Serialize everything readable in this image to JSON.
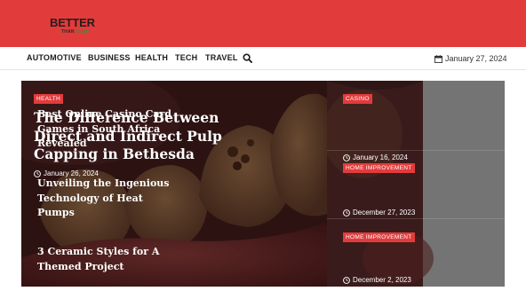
{
  "brand": {
    "logo_main": "BETTER",
    "logo_sub_1": "THAN",
    "logo_sub_2": "RIGHT"
  },
  "nav": {
    "items": [
      "AUTOMOTIVE",
      "BUSINESS",
      "HEALTH",
      "TECH",
      "TRAVEL"
    ],
    "search_icon": "search-icon",
    "date": "January 27, 2024",
    "date_icon": "calendar-icon"
  },
  "featured": {
    "category": "HEALTH",
    "title": "The Difference Between Direct and Indirect Pulp Capping in Bethesda",
    "date": "January 26, 2024"
  },
  "side_posts": [
    {
      "category": "CASINO",
      "title": "Best Online Casino Card Games in South Africa Revealed",
      "date": "January 16, 2024"
    },
    {
      "category": "HOME IMPROVEMENT",
      "title": "Unveiling the Ingenious Technology of Heat Pumps",
      "date": "December 27, 2023"
    },
    {
      "category": "HOME IMPROVEMENT",
      "title": "3 Ceramic Styles for A Themed Project",
      "date": "December 2, 2023"
    }
  ],
  "colors": {
    "accent": "#e23b3b",
    "overlay": "#3b1f1f",
    "side_overlay": "#6b6b6b"
  }
}
